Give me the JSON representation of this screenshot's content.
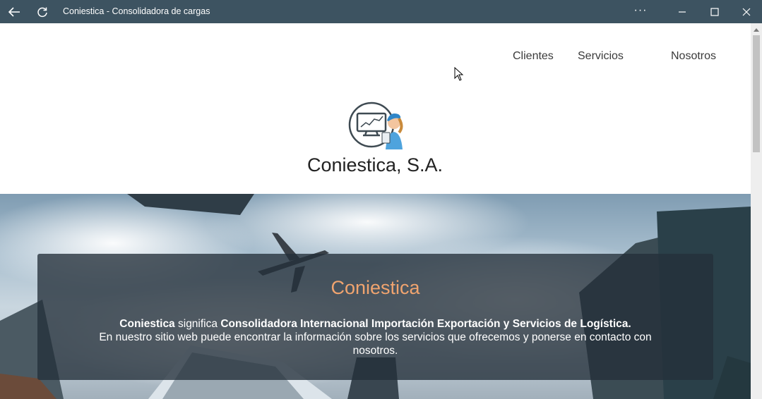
{
  "window": {
    "title": "Coniestica - Consolidadora de cargas",
    "more_label": "···"
  },
  "nav": {
    "items": [
      "Clientes",
      "Servicios",
      "Nosotros"
    ]
  },
  "brand": {
    "name": "Coniestica, S.A."
  },
  "hero": {
    "panel_title": "Coniestica",
    "desc_bold_1": "Coniestica",
    "desc_text_1": " significa ",
    "desc_bold_2": "Consolidadora Internacional Importación Exportación y Servicios de Logística.",
    "desc_text_2": "En nuestro sitio web puede encontrar la información sobre los servicios que ofrecemos y ponerse en contacto con nosotros."
  },
  "colors": {
    "titlebar": "#3d5361",
    "accent": "#f0a46f",
    "panel": "#24303a"
  },
  "icons": [
    "back-arrow-icon",
    "refresh-icon",
    "more-icon",
    "minimize-icon",
    "maximize-icon",
    "close-icon",
    "scroll-up-icon",
    "mouse-cursor-icon"
  ]
}
